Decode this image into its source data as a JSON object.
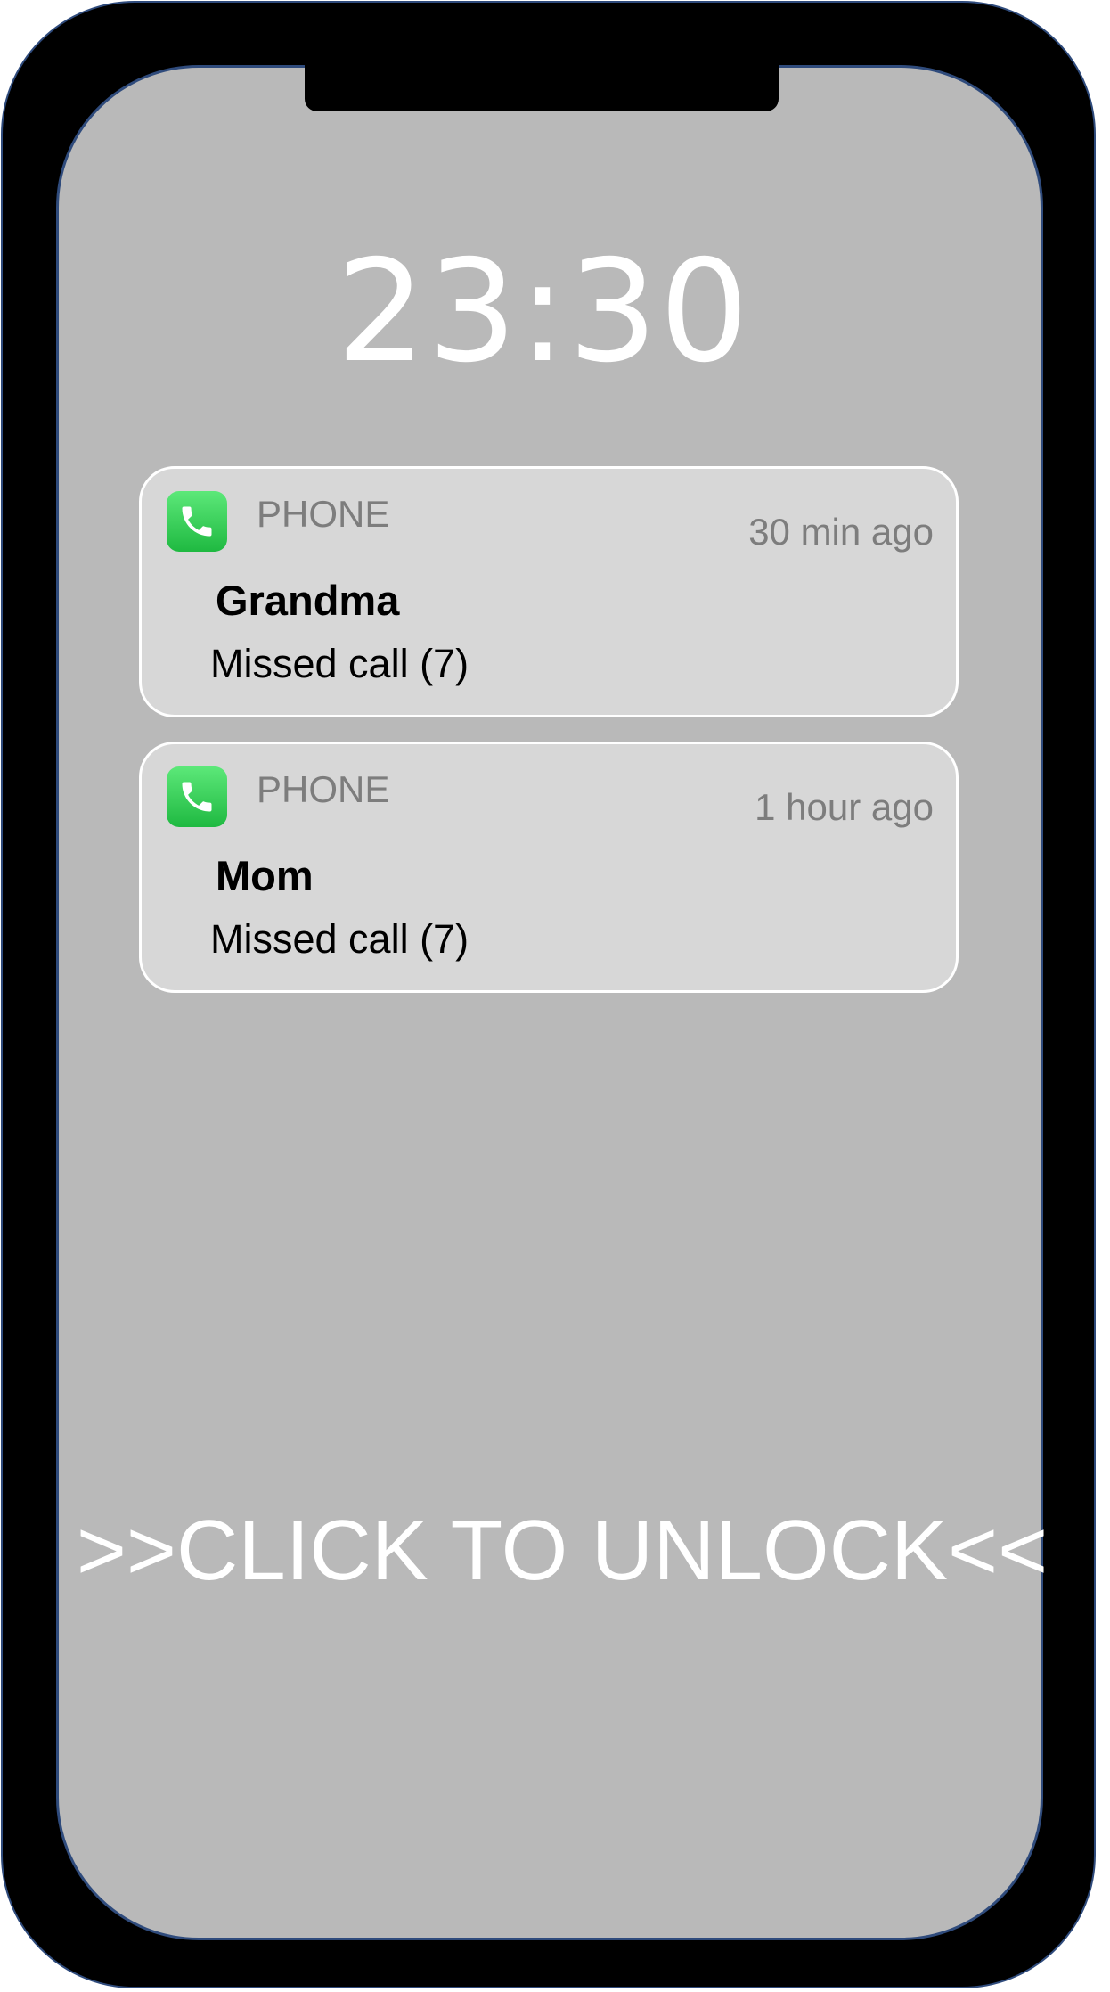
{
  "lockscreen": {
    "time": "23:30",
    "unlock_label": ">>CLICK TO UNLOCK<<"
  },
  "notifications": [
    {
      "app": "PHONE",
      "app_icon": "phone-icon",
      "time_ago": "30 min ago",
      "caller": "Grandma",
      "detail": "Missed call (7)"
    },
    {
      "app": "PHONE",
      "app_icon": "phone-icon",
      "time_ago": "1 hour ago",
      "caller": "Mom",
      "detail": "Missed call (7)"
    }
  ],
  "colors": {
    "frame": "#000000",
    "screen": "#b9b9b9",
    "card": "#d7d7d7",
    "phone_icon_green": "#34d058",
    "outline": "#2f4b7c"
  }
}
